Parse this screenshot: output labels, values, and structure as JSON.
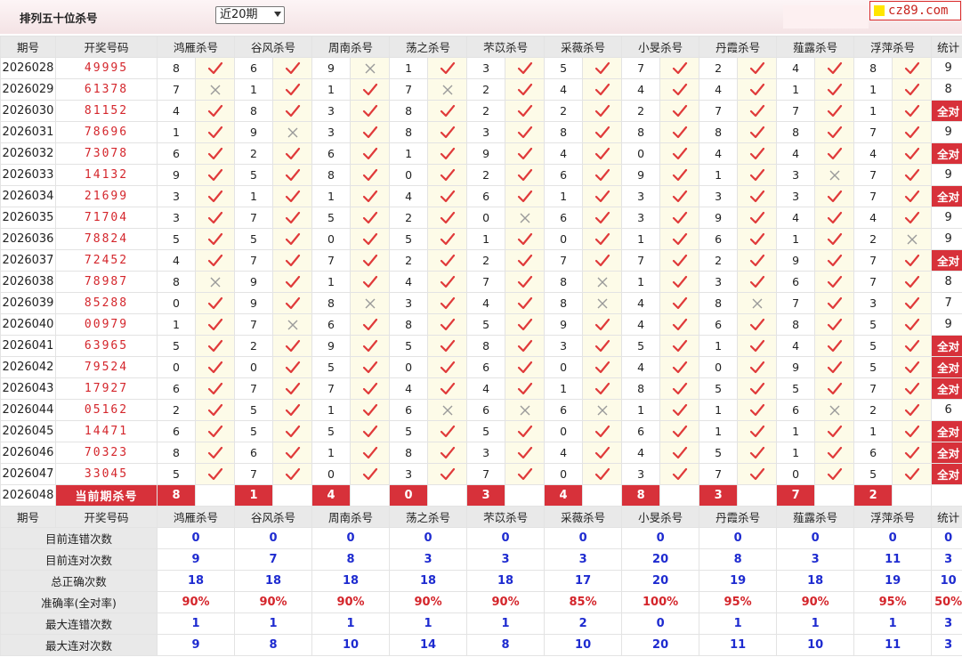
{
  "header": {
    "page_title": "排列五十位杀号",
    "period_select": "近20期",
    "logo": "cz89.com"
  },
  "columns": {
    "period": "期号",
    "numbers": "开奖号码",
    "experts": [
      "鸿雁杀号",
      "谷风杀号",
      "周南杀号",
      "荡之杀号",
      "芣苡杀号",
      "采薇杀号",
      "小旻杀号",
      "丹霞杀号",
      "薤露杀号",
      "浮萍杀号"
    ],
    "total": "统计"
  },
  "rows": [
    {
      "period": "2026028",
      "numbers": "49995",
      "kills": [
        "8",
        "6",
        "9",
        "1",
        "3",
        "5",
        "7",
        "2",
        "4",
        "8"
      ],
      "marks": [
        "ok",
        "ok",
        "x",
        "ok",
        "ok",
        "ok",
        "ok",
        "ok",
        "ok",
        "ok"
      ],
      "total": "9"
    },
    {
      "period": "2026029",
      "numbers": "61378",
      "kills": [
        "7",
        "1",
        "1",
        "7",
        "2",
        "4",
        "4",
        "4",
        "1",
        "1"
      ],
      "marks": [
        "x",
        "ok",
        "ok",
        "x",
        "ok",
        "ok",
        "ok",
        "ok",
        "ok",
        "ok"
      ],
      "total": "8"
    },
    {
      "period": "2026030",
      "numbers": "81152",
      "kills": [
        "4",
        "8",
        "3",
        "8",
        "2",
        "2",
        "2",
        "7",
        "7",
        "1"
      ],
      "marks": [
        "ok",
        "ok",
        "ok",
        "ok",
        "ok",
        "ok",
        "ok",
        "ok",
        "ok",
        "ok"
      ],
      "total": "全对"
    },
    {
      "period": "2026031",
      "numbers": "78696",
      "kills": [
        "1",
        "9",
        "3",
        "8",
        "3",
        "8",
        "8",
        "8",
        "8",
        "7"
      ],
      "marks": [
        "ok",
        "x",
        "ok",
        "ok",
        "ok",
        "ok",
        "ok",
        "ok",
        "ok",
        "ok"
      ],
      "total": "9"
    },
    {
      "period": "2026032",
      "numbers": "73078",
      "kills": [
        "6",
        "2",
        "6",
        "1",
        "9",
        "4",
        "0",
        "4",
        "4",
        "4"
      ],
      "marks": [
        "ok",
        "ok",
        "ok",
        "ok",
        "ok",
        "ok",
        "ok",
        "ok",
        "ok",
        "ok"
      ],
      "total": "全对"
    },
    {
      "period": "2026033",
      "numbers": "14132",
      "kills": [
        "9",
        "5",
        "8",
        "0",
        "2",
        "6",
        "9",
        "1",
        "3",
        "7"
      ],
      "marks": [
        "ok",
        "ok",
        "ok",
        "ok",
        "ok",
        "ok",
        "ok",
        "ok",
        "x",
        "ok"
      ],
      "total": "9"
    },
    {
      "period": "2026034",
      "numbers": "21699",
      "kills": [
        "3",
        "1",
        "1",
        "4",
        "6",
        "1",
        "3",
        "3",
        "3",
        "7"
      ],
      "marks": [
        "ok",
        "ok",
        "ok",
        "ok",
        "ok",
        "ok",
        "ok",
        "ok",
        "ok",
        "ok"
      ],
      "total": "全对"
    },
    {
      "period": "2026035",
      "numbers": "71704",
      "kills": [
        "3",
        "7",
        "5",
        "2",
        "0",
        "6",
        "3",
        "9",
        "4",
        "4"
      ],
      "marks": [
        "ok",
        "ok",
        "ok",
        "ok",
        "x",
        "ok",
        "ok",
        "ok",
        "ok",
        "ok"
      ],
      "total": "9"
    },
    {
      "period": "2026036",
      "numbers": "78824",
      "kills": [
        "5",
        "5",
        "0",
        "5",
        "1",
        "0",
        "1",
        "6",
        "1",
        "2"
      ],
      "marks": [
        "ok",
        "ok",
        "ok",
        "ok",
        "ok",
        "ok",
        "ok",
        "ok",
        "ok",
        "x"
      ],
      "total": "9"
    },
    {
      "period": "2026037",
      "numbers": "72452",
      "kills": [
        "4",
        "7",
        "7",
        "2",
        "2",
        "7",
        "7",
        "2",
        "9",
        "7"
      ],
      "marks": [
        "ok",
        "ok",
        "ok",
        "ok",
        "ok",
        "ok",
        "ok",
        "ok",
        "ok",
        "ok"
      ],
      "total": "全对"
    },
    {
      "period": "2026038",
      "numbers": "78987",
      "kills": [
        "8",
        "9",
        "1",
        "4",
        "7",
        "8",
        "1",
        "3",
        "6",
        "7"
      ],
      "marks": [
        "x",
        "ok",
        "ok",
        "ok",
        "ok",
        "x",
        "ok",
        "ok",
        "ok",
        "ok"
      ],
      "total": "8"
    },
    {
      "period": "2026039",
      "numbers": "85288",
      "kills": [
        "0",
        "9",
        "8",
        "3",
        "4",
        "8",
        "4",
        "8",
        "7",
        "3"
      ],
      "marks": [
        "ok",
        "ok",
        "x",
        "ok",
        "ok",
        "x",
        "ok",
        "x",
        "ok",
        "ok"
      ],
      "total": "7"
    },
    {
      "period": "2026040",
      "numbers": "00979",
      "kills": [
        "1",
        "7",
        "6",
        "8",
        "5",
        "9",
        "4",
        "6",
        "8",
        "5"
      ],
      "marks": [
        "ok",
        "x",
        "ok",
        "ok",
        "ok",
        "ok",
        "ok",
        "ok",
        "ok",
        "ok"
      ],
      "total": "9"
    },
    {
      "period": "2026041",
      "numbers": "63965",
      "kills": [
        "5",
        "2",
        "9",
        "5",
        "8",
        "3",
        "5",
        "1",
        "4",
        "5"
      ],
      "marks": [
        "ok",
        "ok",
        "ok",
        "ok",
        "ok",
        "ok",
        "ok",
        "ok",
        "ok",
        "ok"
      ],
      "total": "全对"
    },
    {
      "period": "2026042",
      "numbers": "79524",
      "kills": [
        "0",
        "0",
        "5",
        "0",
        "6",
        "0",
        "4",
        "0",
        "9",
        "5"
      ],
      "marks": [
        "ok",
        "ok",
        "ok",
        "ok",
        "ok",
        "ok",
        "ok",
        "ok",
        "ok",
        "ok"
      ],
      "total": "全对"
    },
    {
      "period": "2026043",
      "numbers": "17927",
      "kills": [
        "6",
        "7",
        "7",
        "4",
        "4",
        "1",
        "8",
        "5",
        "5",
        "7"
      ],
      "marks": [
        "ok",
        "ok",
        "ok",
        "ok",
        "ok",
        "ok",
        "ok",
        "ok",
        "ok",
        "ok"
      ],
      "total": "全对"
    },
    {
      "period": "2026044",
      "numbers": "05162",
      "kills": [
        "2",
        "5",
        "1",
        "6",
        "6",
        "6",
        "1",
        "1",
        "6",
        "2"
      ],
      "marks": [
        "ok",
        "ok",
        "ok",
        "x",
        "x",
        "x",
        "ok",
        "ok",
        "x",
        "ok"
      ],
      "total": "6"
    },
    {
      "period": "2026045",
      "numbers": "14471",
      "kills": [
        "6",
        "5",
        "5",
        "5",
        "5",
        "0",
        "6",
        "1",
        "1",
        "1"
      ],
      "marks": [
        "ok",
        "ok",
        "ok",
        "ok",
        "ok",
        "ok",
        "ok",
        "ok",
        "ok",
        "ok"
      ],
      "total": "全对"
    },
    {
      "period": "2026046",
      "numbers": "70323",
      "kills": [
        "8",
        "6",
        "1",
        "8",
        "3",
        "4",
        "4",
        "5",
        "1",
        "6"
      ],
      "marks": [
        "ok",
        "ok",
        "ok",
        "ok",
        "ok",
        "ok",
        "ok",
        "ok",
        "ok",
        "ok"
      ],
      "total": "全对"
    },
    {
      "period": "2026047",
      "numbers": "33045",
      "kills": [
        "5",
        "7",
        "0",
        "3",
        "7",
        "0",
        "3",
        "7",
        "0",
        "5"
      ],
      "marks": [
        "ok",
        "ok",
        "ok",
        "ok",
        "ok",
        "ok",
        "ok",
        "ok",
        "ok",
        "ok"
      ],
      "total": "全对"
    }
  ],
  "current": {
    "period": "2026048",
    "label": "当前期杀号",
    "kills": [
      "8",
      "1",
      "4",
      "0",
      "3",
      "4",
      "8",
      "3",
      "7",
      "2"
    ]
  },
  "stats": [
    {
      "label": "目前连错次数",
      "values": [
        "0",
        "0",
        "0",
        "0",
        "0",
        "0",
        "0",
        "0",
        "0",
        "0"
      ],
      "total": "0",
      "style": "v"
    },
    {
      "label": "目前连对次数",
      "values": [
        "9",
        "7",
        "8",
        "3",
        "3",
        "3",
        "20",
        "8",
        "3",
        "11"
      ],
      "total": "3",
      "style": "v"
    },
    {
      "label": "总正确次数",
      "values": [
        "18",
        "18",
        "18",
        "18",
        "18",
        "17",
        "20",
        "19",
        "18",
        "19"
      ],
      "total": "10",
      "style": "v"
    },
    {
      "label": "准确率(全对率)",
      "values": [
        "90%",
        "90%",
        "90%",
        "90%",
        "90%",
        "85%",
        "100%",
        "95%",
        "90%",
        "95%"
      ],
      "total": "50%",
      "style": "r"
    },
    {
      "label": "最大连错次数",
      "values": [
        "1",
        "1",
        "1",
        "1",
        "1",
        "2",
        "0",
        "1",
        "1",
        "1"
      ],
      "total": "3",
      "style": "v"
    },
    {
      "label": "最大连对次数",
      "values": [
        "9",
        "8",
        "10",
        "14",
        "8",
        "10",
        "20",
        "11",
        "10",
        "11"
      ],
      "total": "3",
      "style": "v"
    }
  ],
  "colors": {
    "accent": "#d7313a",
    "stat_blue": "#1e2bd0",
    "mark_bg": "#fdfbe8",
    "check": "#e03a3a",
    "cross": "#9a9a9a"
  },
  "icons": {
    "ok": "check-icon",
    "x": "cross-icon"
  }
}
